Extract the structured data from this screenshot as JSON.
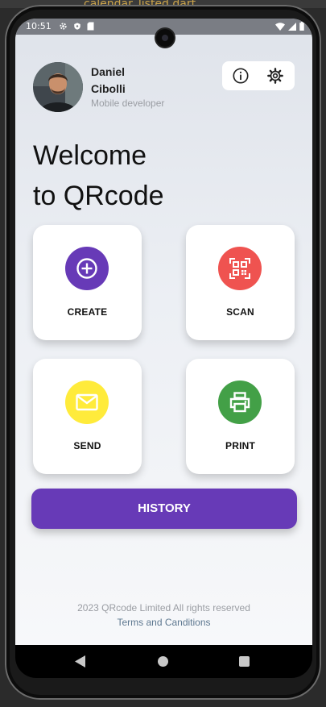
{
  "desktop": {
    "tab_text": "calendar_listed.dart"
  },
  "status_bar": {
    "time": "10:51"
  },
  "user": {
    "first_name": "Daniel",
    "last_name": "Cibolli",
    "role": "Mobile developer"
  },
  "welcome": {
    "line1": "Welcome",
    "line2": "to QRcode"
  },
  "actions": [
    {
      "label": "CREATE",
      "icon": "plus-circle-icon",
      "color": "#673ab7"
    },
    {
      "label": "SCAN",
      "icon": "qr-scan-icon",
      "color": "#ef5350"
    },
    {
      "label": "SEND",
      "icon": "mail-icon",
      "color": "#ffeb3b"
    },
    {
      "label": "PRINT",
      "icon": "printer-icon",
      "color": "#43a047"
    }
  ],
  "history": {
    "label": "HISTORY",
    "color": "#673ab7"
  },
  "footer": {
    "copyright": "2023 QRcode Limited All rights reserved",
    "terms": "Terms and Canditions"
  },
  "top_actions": {
    "info_icon": "info-icon",
    "settings_icon": "gear-icon"
  }
}
